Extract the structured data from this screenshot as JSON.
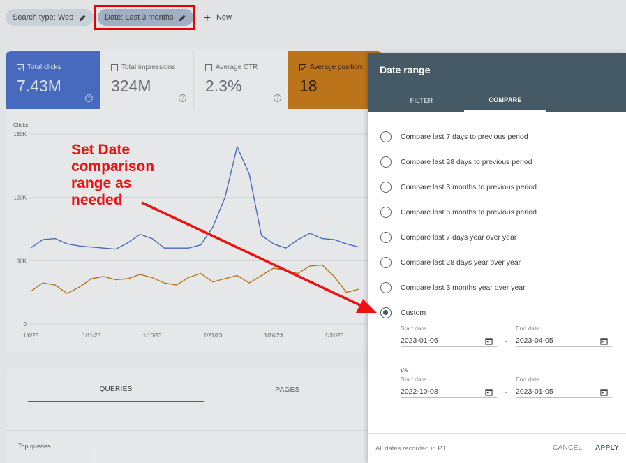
{
  "filters": {
    "search_type": "Search type: Web",
    "date": "Date: Last 3 months",
    "new_label": "New"
  },
  "metrics": [
    {
      "label": "Total clicks",
      "value": "7.43M",
      "checked": true
    },
    {
      "label": "Total impressions",
      "value": "324M",
      "checked": false
    },
    {
      "label": "Average CTR",
      "value": "2.3%",
      "checked": false
    },
    {
      "label": "Average position",
      "value": "18",
      "checked": true
    }
  ],
  "chart_data": {
    "type": "line",
    "ylabel": "Clicks",
    "yticks": [
      "180K",
      "120K",
      "60K",
      "0"
    ],
    "ylim": [
      0,
      180000
    ],
    "xticks": [
      "1/6/23",
      "1/11/23",
      "1/16/23",
      "1/21/23",
      "1/26/23",
      "1/31/23"
    ],
    "x": [
      "1/6/23",
      "1/7/23",
      "1/8/23",
      "1/9/23",
      "1/10/23",
      "1/11/23",
      "1/12/23",
      "1/13/23",
      "1/14/23",
      "1/15/23",
      "1/16/23",
      "1/17/23",
      "1/18/23",
      "1/19/23",
      "1/20/23",
      "1/21/23",
      "1/22/23",
      "1/23/23",
      "1/24/23",
      "1/25/23",
      "1/26/23",
      "1/27/23",
      "1/28/23",
      "1/29/23",
      "1/30/23",
      "1/31/23",
      "2/1/23",
      "2/2/23"
    ],
    "series": [
      {
        "color": "#4a6fc9",
        "values": [
          72000,
          80000,
          81000,
          76000,
          74000,
          73000,
          72000,
          71000,
          77000,
          85000,
          81000,
          72000,
          72000,
          72000,
          75000,
          92000,
          120000,
          168000,
          142000,
          84000,
          76000,
          72000,
          80000,
          86000,
          81000,
          80000,
          76000,
          73000
        ]
      },
      {
        "color": "#c67a1a",
        "values": [
          31000,
          39000,
          37000,
          29000,
          35000,
          43000,
          45000,
          42000,
          43000,
          47000,
          44000,
          39000,
          37000,
          44000,
          48000,
          40000,
          43000,
          46000,
          39000,
          46000,
          53000,
          51000,
          48000,
          55000,
          56000,
          45000,
          30000,
          33000
        ]
      }
    ]
  },
  "content_tabs": {
    "queries": "QUERIES",
    "pages": "PAGES",
    "top_queries": "Top queries"
  },
  "panel": {
    "title": "Date range",
    "tabs": [
      "FILTER",
      "COMPARE"
    ],
    "options": [
      {
        "label": "Compare last 7 days to previous period",
        "selected": false
      },
      {
        "label": "Compare last 28 days to previous period",
        "selected": false
      },
      {
        "label": "Compare last 3 months to previous period",
        "selected": false
      },
      {
        "label": "Compare last 6 months to previous period",
        "selected": false
      },
      {
        "label": "Compare last 7 days year over year",
        "selected": false
      },
      {
        "label": "Compare last 28 days year over year",
        "selected": false
      },
      {
        "label": "Compare last 3 months year over year",
        "selected": false
      },
      {
        "label": "Custom",
        "selected": true
      }
    ],
    "start_date_label": "Start date",
    "end_date_label": "End date",
    "range1_start": "2023-01-06",
    "range1_end": "2023-04-05",
    "vs_label": "vs.",
    "range2_start": "2022-10-08",
    "range2_end": "2023-01-05",
    "dash": "-",
    "footer_note": "All dates recorded in PT.",
    "cancel": "CANCEL",
    "apply": "APPLY"
  },
  "annotation": {
    "lines": [
      "Set Date",
      "comparison",
      "range as",
      "needed"
    ],
    "color": "#ee1111"
  },
  "icons": {
    "pencil": "pencil-icon",
    "plus": "plus-icon",
    "calendar": "calendar-icon",
    "help": "help-icon",
    "help_glyph": "?",
    "plus_glyph": "+"
  }
}
